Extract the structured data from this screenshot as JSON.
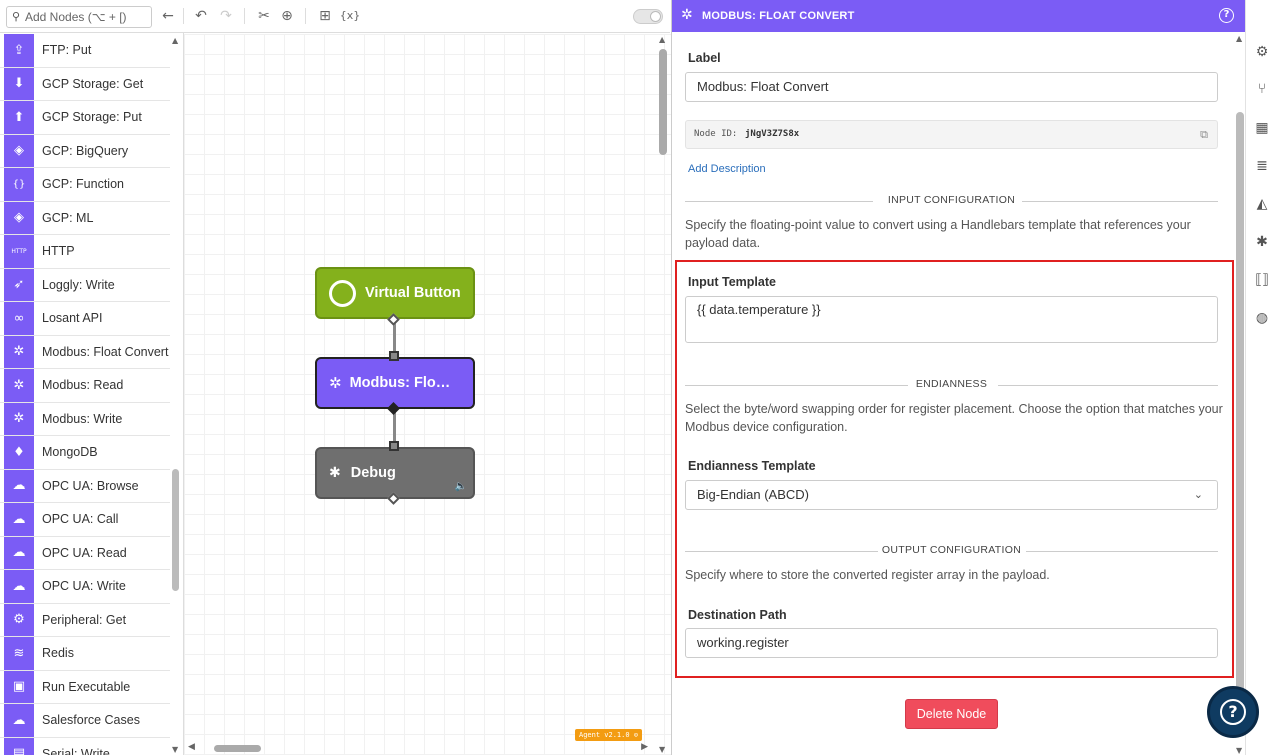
{
  "toolbar": {
    "search_placeholder": "Add Nodes (⌥ + [)",
    "undo_icon": "↶",
    "redo_icon": "↷",
    "back_icon": "←",
    "cut_icon": "✂",
    "zoom_icon": "⊕",
    "add_comment_icon": "⊞",
    "variables_icon": "{x}"
  },
  "palette": {
    "items": [
      {
        "label": "FTP: Put",
        "icon": "⇪"
      },
      {
        "label": "GCP Storage: Get",
        "icon": "⬇"
      },
      {
        "label": "GCP Storage: Put",
        "icon": "⬆"
      },
      {
        "label": "GCP: BigQuery",
        "icon": "◈"
      },
      {
        "label": "GCP: Function",
        "icon": "{}"
      },
      {
        "label": "GCP: ML",
        "icon": "◈"
      },
      {
        "label": "HTTP",
        "icon": "HTTP"
      },
      {
        "label": "Loggly: Write",
        "icon": "➶"
      },
      {
        "label": "Losant API",
        "icon": "∞"
      },
      {
        "label": "Modbus: Float Convert",
        "icon": "✲"
      },
      {
        "label": "Modbus: Read",
        "icon": "✲"
      },
      {
        "label": "Modbus: Write",
        "icon": "✲"
      },
      {
        "label": "MongoDB",
        "icon": "♦"
      },
      {
        "label": "OPC UA: Browse",
        "icon": "☁"
      },
      {
        "label": "OPC UA: Call",
        "icon": "☁"
      },
      {
        "label": "OPC UA: Read",
        "icon": "☁"
      },
      {
        "label": "OPC UA: Write",
        "icon": "☁"
      },
      {
        "label": "Peripheral: Get",
        "icon": "⚙"
      },
      {
        "label": "Redis",
        "icon": "≋"
      },
      {
        "label": "Run Executable",
        "icon": "▣"
      },
      {
        "label": "Salesforce Cases",
        "icon": "☁"
      },
      {
        "label": "Serial: Write",
        "icon": "▤"
      }
    ]
  },
  "canvas": {
    "nodes": {
      "virtual_button": "Virtual Button",
      "modbus": "Modbus: Flo…",
      "debug": "Debug"
    },
    "agent_badge": "Agent v2.1.0 ⊙"
  },
  "panel": {
    "title": "MODBUS: FLOAT CONVERT",
    "label_field": {
      "label": "Label",
      "value": "Modbus: Float Convert"
    },
    "node_id": {
      "label": "Node ID:",
      "value": "jNgV3Z7S8x"
    },
    "add_description": "Add Description",
    "input_config": {
      "title": "INPUT CONFIGURATION",
      "desc": "Specify the floating-point value to convert using a Handlebars template that references your payload data.",
      "template_label": "Input Template",
      "template_value": "{{ data.temperature }}"
    },
    "endianness": {
      "title": "ENDIANNESS",
      "desc": "Select the byte/word swapping order for register placement. Choose the option that matches your Modbus device configuration.",
      "template_label": "Endianness Template",
      "selected": "Big-Endian (ABCD)"
    },
    "output_config": {
      "title": "OUTPUT CONFIGURATION",
      "desc": "Specify where to store the converted register array in the payload.",
      "path_label": "Destination Path",
      "path_value": "working.register"
    },
    "delete_button": "Delete Node"
  },
  "rail": {
    "icons": [
      "gear-icon",
      "branch-icon",
      "chip-icon",
      "database-icon",
      "chart-icon",
      "bug-icon",
      "code-icon",
      "globe-icon"
    ]
  },
  "colors": {
    "accent": "#7b5cf5",
    "virtual_button": "#84b11c",
    "debug": "#6f6f6f",
    "delete": "#f04c5c",
    "highlight": "#e02020",
    "help_fab": "#0f3b61"
  }
}
